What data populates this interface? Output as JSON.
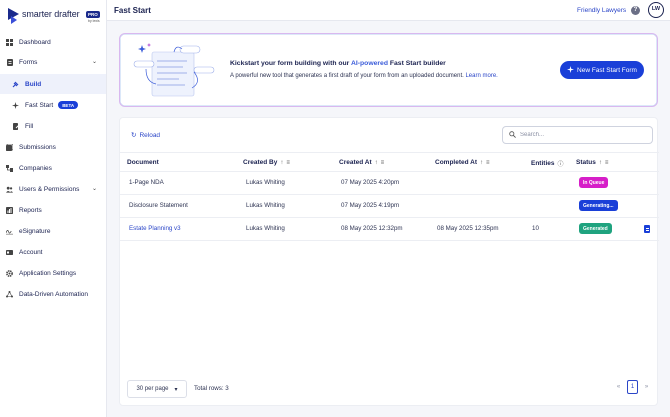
{
  "app": {
    "brand_name": "smarter drafter",
    "brand_badge": "PRO",
    "brand_sub": "by lexis"
  },
  "sidebar": {
    "items": [
      {
        "label": "Dashboard",
        "icon": "dashboard-icon"
      },
      {
        "label": "Forms",
        "icon": "forms-icon"
      },
      {
        "label": "Build",
        "icon": "build-icon"
      },
      {
        "label": "Fast Start",
        "icon": "sparkle-icon",
        "badge": "BETA"
      },
      {
        "label": "Fill",
        "icon": "fill-icon"
      },
      {
        "label": "Submissions",
        "icon": "submissions-icon"
      },
      {
        "label": "Companies",
        "icon": "companies-icon"
      },
      {
        "label": "Users & Permissions",
        "icon": "users-icon"
      },
      {
        "label": "Reports",
        "icon": "reports-icon"
      },
      {
        "label": "eSignature",
        "icon": "signature-icon"
      },
      {
        "label": "Account",
        "icon": "account-icon"
      },
      {
        "label": "Application Settings",
        "icon": "gear-icon"
      },
      {
        "label": "Data-Driven Automation",
        "icon": "automation-icon"
      }
    ]
  },
  "header": {
    "title": "Fast Start",
    "org": "Friendly Lawyers",
    "help": "?",
    "avatar": "LW"
  },
  "banner": {
    "title_pre": "Kickstart your form building with our ",
    "title_ai": "AI-powered",
    "title_post": " Fast Start builder",
    "desc": "A powerful new tool that generates a first draft of your form from an uploaded document. ",
    "learn_more": "Learn more.",
    "button": "New Fast Start Form"
  },
  "table": {
    "reload": "Reload",
    "search_placeholder": "Search...",
    "columns": [
      "Document",
      "Created By",
      "Created At",
      "Completed At",
      "Entities",
      "Status"
    ],
    "rows": [
      {
        "document": "1-Page NDA",
        "created_by": "Lukas Whiting",
        "created_at": "07 May 2025 4:20pm",
        "completed_at": "",
        "entities": "",
        "status": "In Queue",
        "status_color": "#d61ec8",
        "is_link": false
      },
      {
        "document": "Disclosure Statement",
        "created_by": "Lukas Whiting",
        "created_at": "07 May 2025 4:19pm",
        "completed_at": "",
        "entities": "",
        "status": "Generating...",
        "status_color": "#1a3fd8",
        "is_link": false
      },
      {
        "document": "Estate Planning v3",
        "created_by": "Lukas Whiting",
        "created_at": "08 May 2025 12:32pm",
        "completed_at": "08 May 2025 12:35pm",
        "entities": "10",
        "status": "Generated",
        "status_color": "#1fa37f",
        "is_link": true
      }
    ],
    "per_page": "30 per page",
    "total_rows": "Total rows: 3",
    "pager": {
      "first": "«",
      "page": "1",
      "last": "»"
    }
  }
}
